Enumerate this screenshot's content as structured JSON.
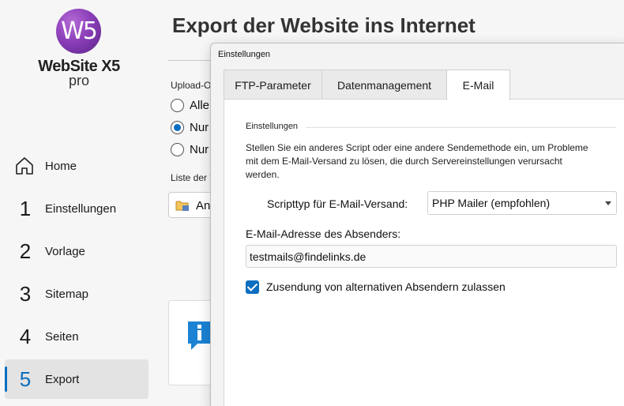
{
  "app": {
    "logo_mark": "W5",
    "logo_name": "WebSite X5",
    "logo_sub": "pro",
    "accent_color": "#0b6ebf",
    "logo_color": "#8b3fb8"
  },
  "sidebar": {
    "items": [
      {
        "num": "",
        "icon": "home-icon",
        "label": "Home"
      },
      {
        "num": "1",
        "label": "Einstellungen"
      },
      {
        "num": "2",
        "label": "Vorlage"
      },
      {
        "num": "3",
        "label": "Sitemap"
      },
      {
        "num": "4",
        "label": "Seiten"
      },
      {
        "num": "5",
        "label": "Export",
        "active": true
      }
    ]
  },
  "main": {
    "title": "Export der Website ins Internet",
    "upload_label": "Upload-O",
    "radios": [
      {
        "label": "Alle",
        "checked": false
      },
      {
        "label": "Nur",
        "checked": true
      },
      {
        "label": "Nur",
        "checked": false
      }
    ],
    "list_label": "Liste der V",
    "an_button": "An"
  },
  "dialog": {
    "title": "Einstellungen",
    "tabs": [
      {
        "label": "FTP-Parameter",
        "active": false
      },
      {
        "label": "Datenmanagement",
        "active": false
      },
      {
        "label": "E-Mail",
        "active": true
      }
    ],
    "group_label": "Einstellungen",
    "description": "Stellen Sie ein anderes Script oder eine andere Sendemethode ein, um Probleme mit dem E-Mail-Versand zu lösen, die  durch Servereinstellungen verursacht werden.",
    "script_label": "Scripttyp für E-Mail-Versand:",
    "script_value": "PHP Mailer (empfohlen)",
    "email_label": "E-Mail-Adresse des Absenders:",
    "email_value": "testmails@findelinks.de",
    "checkbox_label": "Zusendung von alternativen Absendern zulassen",
    "checkbox_checked": true
  }
}
